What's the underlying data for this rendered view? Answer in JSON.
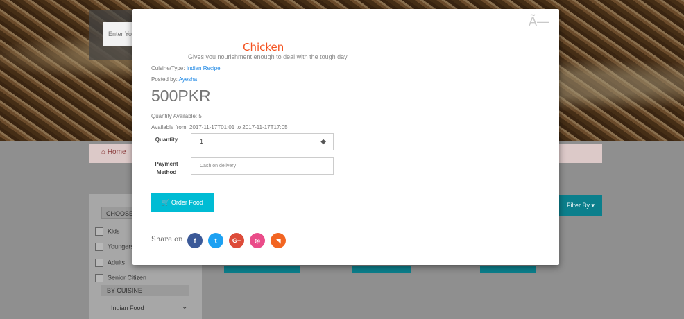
{
  "background": {
    "search_placeholder": "Enter Your",
    "breadcrumb_home": "Home",
    "sidebar": {
      "choose_label": "CHOOSE",
      "items": [
        "Kids",
        "Youngers",
        "Adults",
        "Senior Citizen"
      ],
      "by_cuisine": "BY CUISINE",
      "cuisine_value": "Indian Food"
    },
    "filter_button": "Filter By ▾"
  },
  "modal": {
    "close_glyph": "Ã—",
    "title": "Chicken",
    "subtitle": "Gives you nourishment enough to deal with the tough day",
    "cuisine_label": "Cuisine/Type:",
    "cuisine_value": "Indian Recipe",
    "posted_label": "Posted by:",
    "posted_value": "Ayesha",
    "price": "500PKR",
    "quantity_available": "Quantity Available: 5",
    "available_from": "Available from: 2017-11-17T01:01 to 2017-11-17T17:05",
    "quantity_label": "Quantity",
    "quantity_value": "1",
    "payment_label": "Payment Method",
    "payment_value": "Cash on delivery",
    "order_button": "Order Food",
    "share_label": "Share on",
    "share_icons": [
      {
        "name": "facebook-icon",
        "glyph": "f",
        "color": "#3b5998"
      },
      {
        "name": "twitter-icon",
        "glyph": "t",
        "color": "#1da1f2"
      },
      {
        "name": "google-plus-icon",
        "glyph": "G+",
        "color": "#dd4b39"
      },
      {
        "name": "dribbble-icon",
        "glyph": "◎",
        "color": "#ea4c89"
      },
      {
        "name": "rss-icon",
        "glyph": "◥",
        "color": "#f26522"
      }
    ]
  },
  "colors": {
    "accent": "#00bcd4",
    "title": "#f4511e",
    "link": "#1e88e5",
    "teal": "#0b7f8c"
  }
}
